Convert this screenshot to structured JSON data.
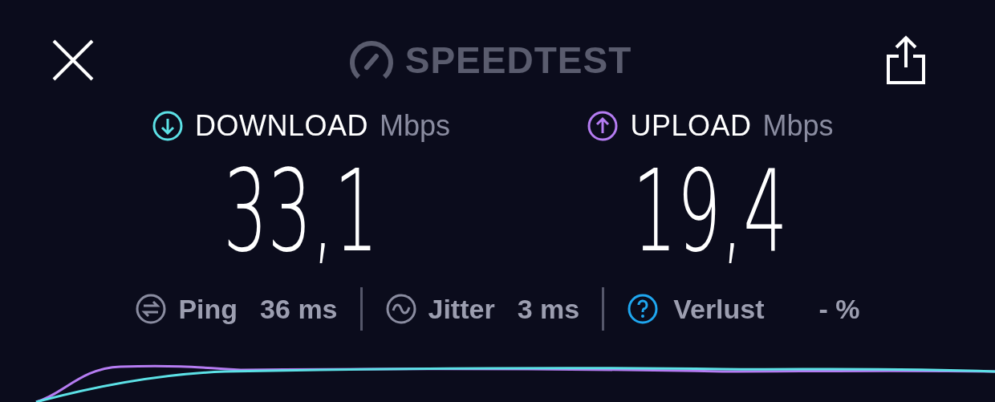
{
  "header": {
    "logo_text": "SPEEDTEST"
  },
  "metrics": [
    {
      "kind": "download",
      "label": "DOWNLOAD",
      "unit": "Mbps",
      "value": "33,1",
      "color": "#5ce1e6"
    },
    {
      "kind": "upload",
      "label": "UPLOAD",
      "unit": "Mbps",
      "value": "19,4",
      "color": "#b57cf2"
    }
  ],
  "stats": [
    {
      "kind": "ping",
      "label": "Ping",
      "value": "36",
      "unit": "ms"
    },
    {
      "kind": "jitter",
      "label": "Jitter",
      "value": "3",
      "unit": "ms"
    },
    {
      "kind": "loss",
      "label": "Verlust",
      "value": "-",
      "unit": "%"
    }
  ]
}
